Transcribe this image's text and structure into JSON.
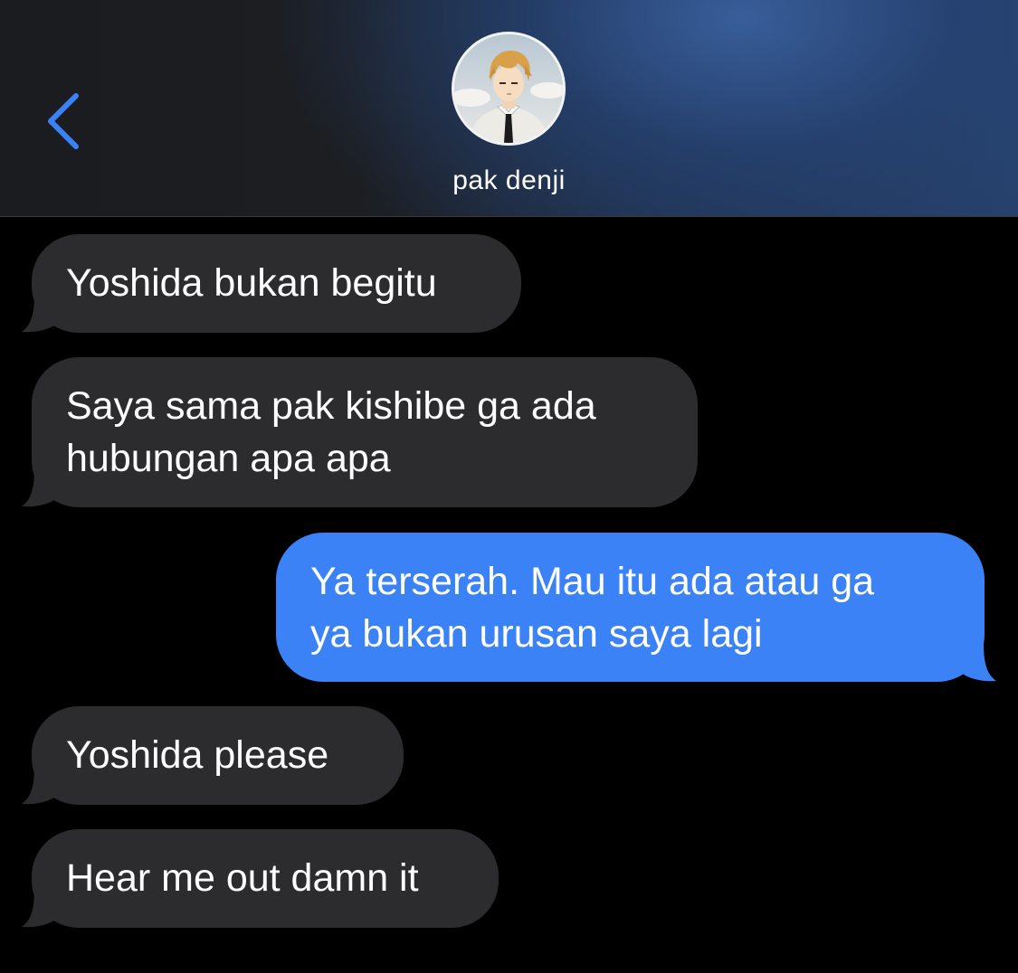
{
  "header": {
    "contact_name": "pak denji",
    "back_icon": "chevron-left-icon",
    "accent_color": "#3b82f6"
  },
  "messages": [
    {
      "direction": "incoming",
      "lines": [
        "Yoshida bukan begitu"
      ]
    },
    {
      "direction": "incoming",
      "lines": [
        "Saya sama pak kishibe ga ada",
        "hubungan apa apa"
      ]
    },
    {
      "direction": "outgoing",
      "lines": [
        "Ya terserah. Mau itu ada atau ga",
        "ya bukan urusan saya lagi"
      ]
    },
    {
      "direction": "incoming",
      "lines": [
        "Yoshida please"
      ]
    },
    {
      "direction": "incoming",
      "lines": [
        "Hear me out damn it"
      ]
    }
  ],
  "colors": {
    "incoming_bubble": "#2c2c2e",
    "outgoing_bubble": "#3a82f6",
    "background": "#000000"
  }
}
